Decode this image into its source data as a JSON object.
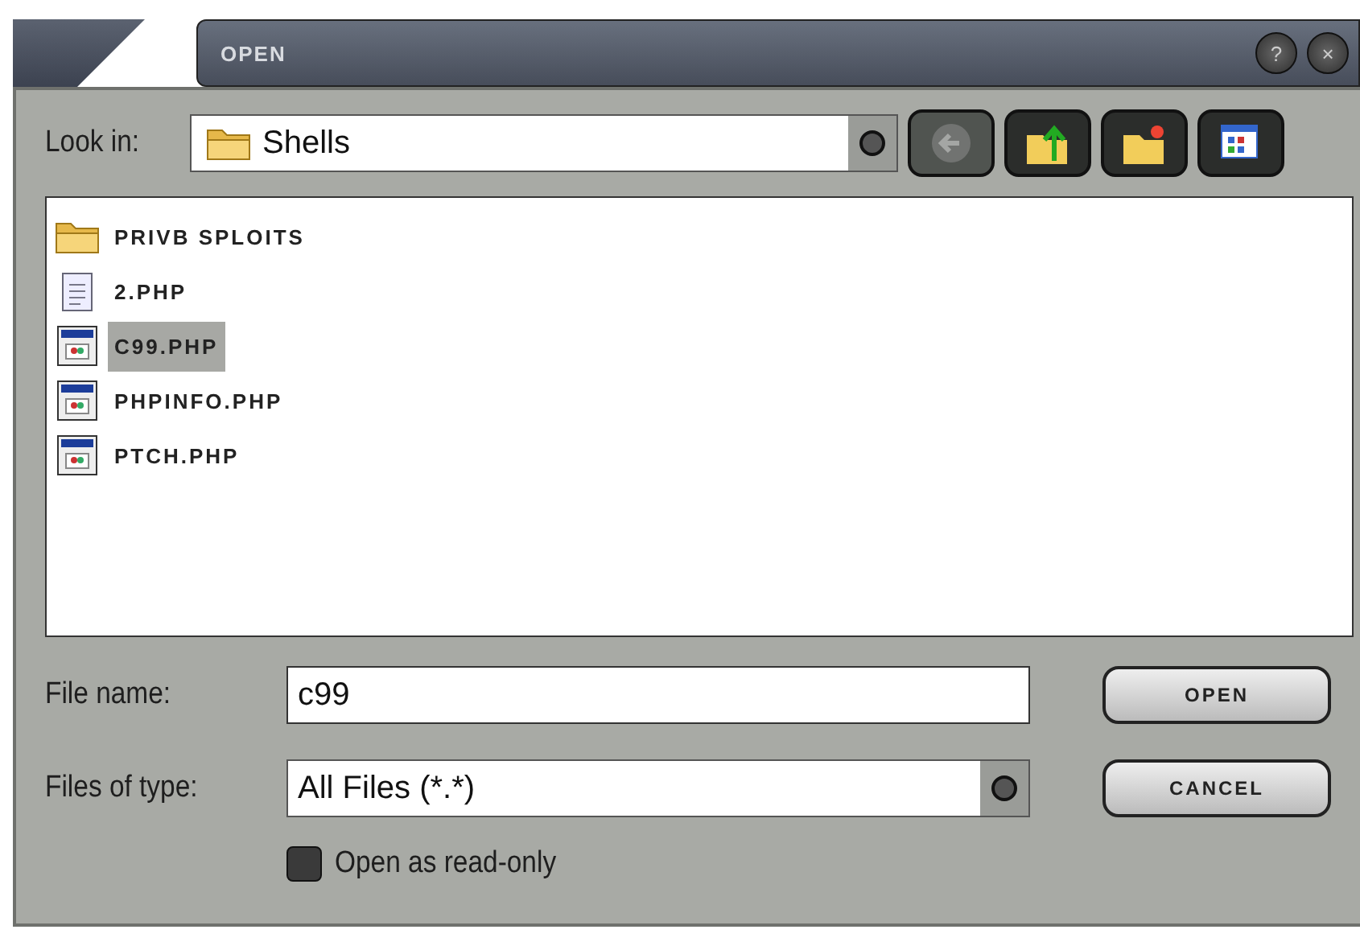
{
  "window": {
    "title": "OPEN"
  },
  "title_buttons": [
    {
      "label": "?"
    },
    {
      "label": "×"
    }
  ],
  "look_in": {
    "label": "Look in:",
    "value": "Shells"
  },
  "toolbar": [
    {
      "kind": "back",
      "disabled": true
    },
    {
      "kind": "up",
      "disabled": false
    },
    {
      "kind": "new-folder",
      "disabled": false
    },
    {
      "kind": "view",
      "disabled": false
    }
  ],
  "files": [
    {
      "name": "PRIVB SPLOITS",
      "kind": "folder",
      "selected": false
    },
    {
      "name": "2.PHP",
      "kind": "text",
      "selected": false
    },
    {
      "name": "C99.PHP",
      "kind": "web",
      "selected": true
    },
    {
      "name": "PHPINFO.PHP",
      "kind": "web",
      "selected": false
    },
    {
      "name": "PTCH.PHP",
      "kind": "web",
      "selected": false
    }
  ],
  "file_name": {
    "label": "File name:",
    "value": "c99"
  },
  "file_type": {
    "label": "Files of type:",
    "value": "All Files (*.*)"
  },
  "read_only": {
    "label": "Open as read-only",
    "checked": false
  },
  "buttons": [
    "OPEN",
    "CANCEL"
  ]
}
